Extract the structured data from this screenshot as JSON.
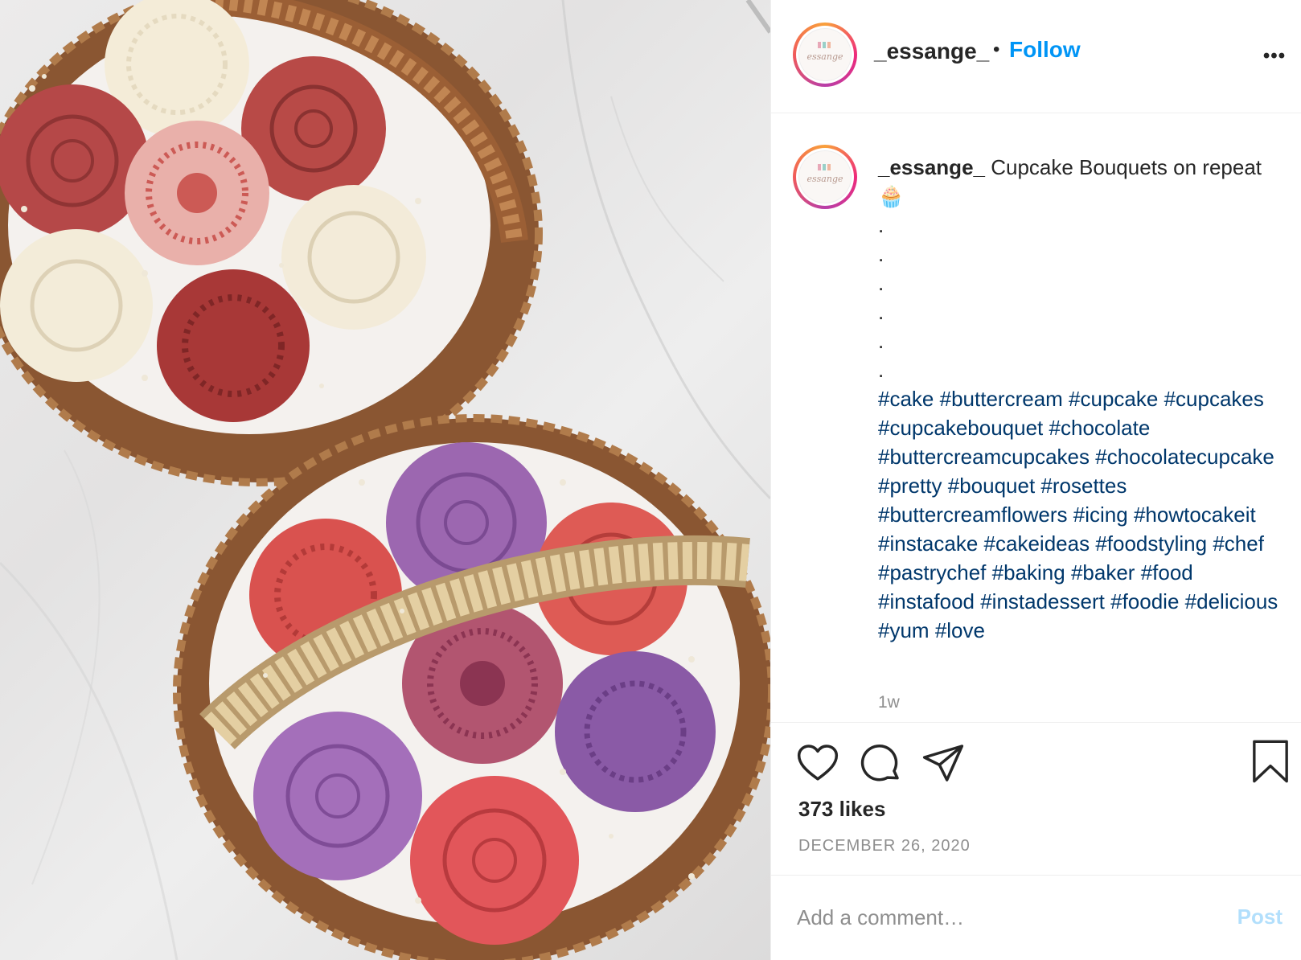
{
  "post": {
    "image_alt": "Two wicker baskets of buttercream flower cupcakes on a marble surface",
    "username": "_essange_",
    "follow_label": "Follow",
    "separator": "•",
    "more_label": "•••",
    "avatar_logo_text": "essange",
    "caption": {
      "username": "_essange_",
      "text": " Cupcake Bouquets on repeat ",
      "emoji": "🧁",
      "dot_lines": [
        ".",
        ".",
        ".",
        ".",
        ".",
        "."
      ],
      "hashtags": [
        "#cake",
        "#buttercream",
        "#cupcake",
        "#cupcakes",
        "#cupcakebouquet",
        "#chocolate",
        "#buttercreamcupcakes",
        "#chocolatecupcake",
        "#pretty",
        "#bouquet",
        "#rosettes",
        "#buttercreamflowers",
        "#icing",
        "#howtocakeit",
        "#instacake",
        "#cakeideas",
        "#foodstyling",
        "#chef",
        "#pastrychef",
        "#baking",
        "#baker",
        "#food",
        "#instafood",
        "#instadessert",
        "#foodie",
        "#delicious",
        "#yum",
        "#love"
      ]
    },
    "time_ago": "1w",
    "likes_text": "373 likes",
    "date": "DECEMBER 26, 2020"
  },
  "comment": {
    "placeholder": "Add a comment…",
    "post_label": "Post"
  },
  "colors": {
    "link_blue": "#0095f6",
    "hashtag_blue": "#00376b",
    "muted": "#8e8e8e",
    "post_disabled": "#b2dffc"
  },
  "icons": [
    "heart-icon",
    "comment-icon",
    "share-icon",
    "bookmark-icon",
    "more-icon"
  ]
}
